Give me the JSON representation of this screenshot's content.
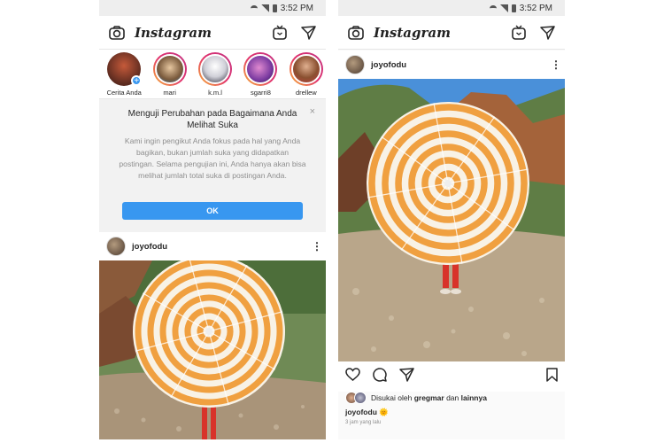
{
  "status_bar": {
    "time": "3:52 PM"
  },
  "app": {
    "logo": "Instagram"
  },
  "stories": [
    {
      "label": "Cerita Anda",
      "own": true
    },
    {
      "label": "mari"
    },
    {
      "label": "k.m.l"
    },
    {
      "label": "sgarri8"
    },
    {
      "label": "drellew"
    }
  ],
  "notice": {
    "title": "Menguji Perubahan pada Bagaimana Anda Melihat Suka",
    "body": "Kami ingin pengikut Anda fokus pada hal yang Anda bagikan, bukan jumlah suka yang didapatkan postingan. Selama pengujian ini, Anda hanya akan bisa melihat jumlah total suka di postingan Anda.",
    "ok_label": "OK",
    "close_icon": "×"
  },
  "post": {
    "username": "joyofodu",
    "liked_by_prefix": "Disukai oleh",
    "liked_by_user": "gregmar",
    "liked_by_joiner": "dan",
    "liked_by_suffix": "lainnya",
    "caption_user": "joyofodu",
    "caption_emoji": "🌞",
    "time_ago": "3 jam yang lalu"
  },
  "colors": {
    "accent": "#3897f0",
    "sky": "#4a90d9",
    "umbrella_orange": "#f0a040",
    "umbrella_white": "#f8f2e6",
    "rocks": "#b7a58c"
  },
  "icons": [
    "camera-icon",
    "igtv-icon",
    "direct-send-icon",
    "more-icon",
    "heart-icon",
    "comment-icon",
    "share-icon",
    "bookmark-icon"
  ]
}
